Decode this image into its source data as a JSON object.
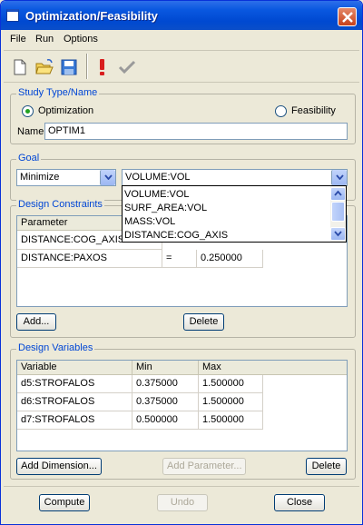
{
  "window": {
    "title": "Optimization/Feasibility"
  },
  "menu": [
    "File",
    "Run",
    "Options"
  ],
  "toolbar": {
    "icons": [
      "new-file-icon",
      "open-folder-icon",
      "save-disk-icon",
      "exclamation-run-icon",
      "checkmark-icon"
    ]
  },
  "study": {
    "legend": "Study Type/Name",
    "optimization_label": "Optimization",
    "feasibility_label": "Feasibility",
    "selected": "Optimization",
    "name_label": "Name",
    "name_value": "OPTIM1"
  },
  "goal": {
    "legend": "Goal",
    "direction": "Minimize",
    "measure": "VOLUME:VOL",
    "options": [
      "VOLUME:VOL",
      "SURF_AREA:VOL",
      "MASS:VOL",
      "DISTANCE:COG_AXIS"
    ]
  },
  "constraints": {
    "legend": "Design Constraints",
    "header": "Parameter",
    "rows": [
      {
        "parameter": "DISTANCE:COG_AXIS",
        "op": "",
        "value": ""
      },
      {
        "parameter": "DISTANCE:PAXOS",
        "op": "=",
        "value": "0.250000"
      }
    ],
    "add_label": "Add...",
    "delete_label": "Delete"
  },
  "variables": {
    "legend": "Design Variables",
    "headers": [
      "Variable",
      "Min",
      "Max"
    ],
    "rows": [
      {
        "variable": "d5:STROFALOS",
        "min": "0.375000",
        "max": "1.500000"
      },
      {
        "variable": "d6:STROFALOS",
        "min": "0.375000",
        "max": "1.500000"
      },
      {
        "variable": "d7:STROFALOS",
        "min": "0.500000",
        "max": "1.500000"
      }
    ],
    "add_dimension_label": "Add Dimension...",
    "add_parameter_label": "Add Parameter...",
    "delete_label": "Delete"
  },
  "footer": {
    "compute_label": "Compute",
    "undo_label": "Undo",
    "close_label": "Close"
  },
  "colors": {
    "title_bar": "#0a58e0",
    "legend_text": "#0046d5",
    "window_bg": "#ece9d8"
  }
}
